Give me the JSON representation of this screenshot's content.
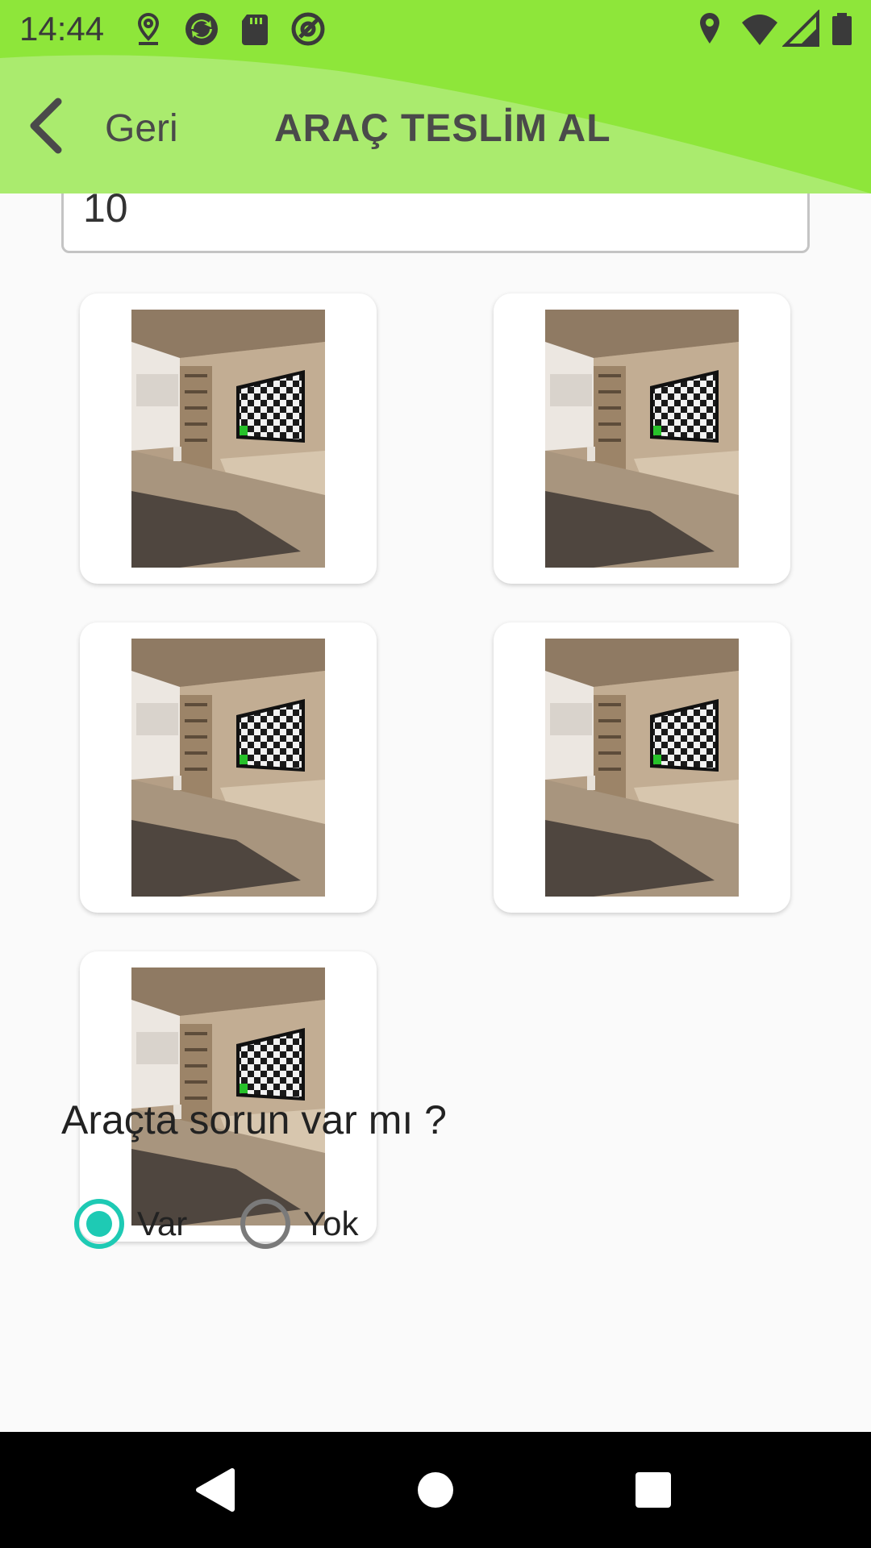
{
  "status_bar": {
    "time": "14:44",
    "left_icons": [
      "location-icon",
      "sync-icon",
      "sd-card-icon",
      "at-sign-icon"
    ],
    "right_icons": [
      "location-icon",
      "wifi-icon",
      "signal-icon",
      "battery-icon"
    ]
  },
  "header": {
    "back_label": "Geri",
    "title": "ARAÇ TESLİM AL",
    "accent_color": "#8ee63a"
  },
  "form": {
    "value_field": "10"
  },
  "photos": [
    {
      "icon": "room-tv-photo"
    },
    {
      "icon": "room-tv-photo"
    },
    {
      "icon": "room-tv-photo"
    },
    {
      "icon": "room-tv-photo"
    },
    {
      "icon": "room-tv-photo"
    }
  ],
  "problem_question": {
    "text": "Araçta sorun var mı ?",
    "options": [
      {
        "label": "Var",
        "selected": true
      },
      {
        "label": "Yok",
        "selected": false
      }
    ],
    "selected_color": "#1ecab4"
  },
  "nav_bar": {
    "buttons": [
      "back-triangle-icon",
      "home-circle-icon",
      "recents-square-icon"
    ]
  }
}
